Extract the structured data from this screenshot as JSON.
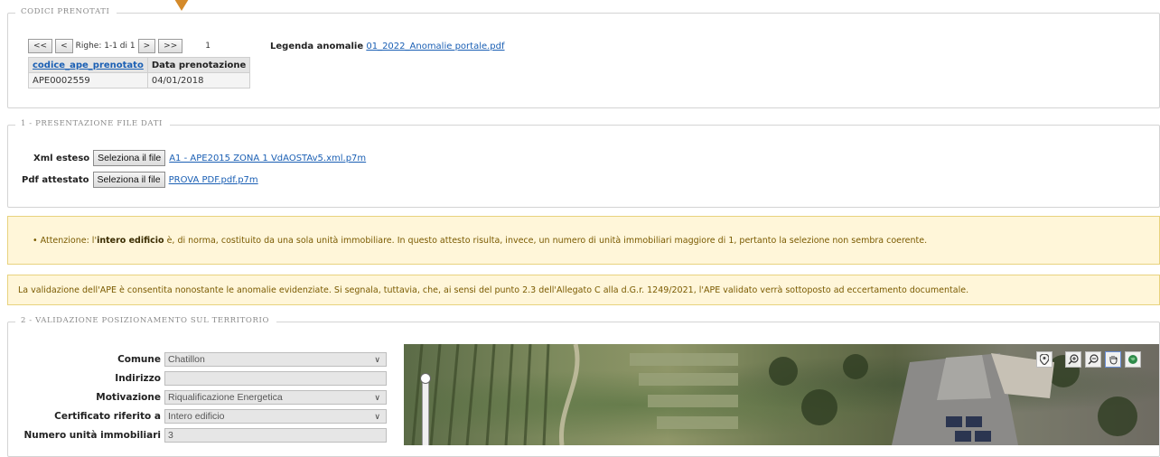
{
  "codici": {
    "legend": "Codici prenotati",
    "pager": {
      "first": "<<",
      "prev": "<",
      "info": "Righe: 1-1 di 1",
      "next": ">",
      "last": ">>",
      "count": "1"
    },
    "legenda_label": "Legenda anomalie",
    "legenda_file": "01_2022_Anomalie portale.pdf",
    "table": {
      "headers": [
        "codice_ape_prenotato",
        "Data prenotazione"
      ],
      "rows": [
        [
          "APE0002559",
          "04/01/2018"
        ]
      ]
    }
  },
  "presentazione": {
    "legend": "1 - Presentazione file dati",
    "xml_label": "Xml esteso",
    "xml_button": "Seleziona il file",
    "xml_file": "A1 - APE2015 ZONA 1 VdAOSTAv5.xml.p7m",
    "pdf_label": "Pdf attestato",
    "pdf_button": "Seleziona il file",
    "pdf_file": "PROVA PDF.pdf.p7m"
  },
  "warning1": {
    "bullet": "•",
    "prefix": "Attenzione: l'",
    "bold": "intero edificio",
    "text": " è, di norma, costituito da una sola unità immobiliare. In questo attesto risulta, invece, un numero di unità immobiliari maggiore di 1, pertanto la selezione non sembra coerente."
  },
  "warning2": {
    "text": "La validazione dell'APE è consentita nonostante le anomalie evidenziate. Si segnala, tuttavia, che, ai sensi del punto 2.3 dell'Allegato C alla d.G.r. 1249/2021, l'APE validato verrà sottoposto ad eccertamento documentale."
  },
  "validazione": {
    "legend": "2 - Validazione posizionamento sul territorio",
    "fields": {
      "comune": {
        "label": "Comune",
        "value": "Chatillon"
      },
      "indirizzo": {
        "label": "Indirizzo",
        "value": ""
      },
      "motivazione": {
        "label": "Motivazione",
        "value": "Riqualificazione Energetica"
      },
      "certificato": {
        "label": "Certificato riferito a",
        "value": "Intero edificio"
      },
      "numero": {
        "label": "Numero unità immobiliari",
        "value": "3"
      }
    }
  },
  "colors": {
    "warning_bg": "#fff6d9",
    "link": "#1a5fb4",
    "accent": "#d48a2a"
  }
}
